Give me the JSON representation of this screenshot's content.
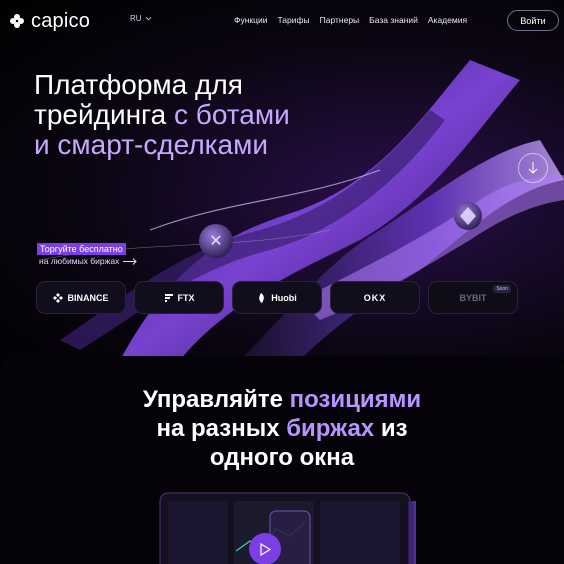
{
  "header": {
    "logo_text": "capico",
    "lang": "RU",
    "nav": [
      "Функции",
      "Тарифы",
      "Партнеры",
      "База знаний",
      "Академия"
    ],
    "login_label": "Войти"
  },
  "hero": {
    "headline_line1": "Платформа для",
    "headline_line2_white": "трейдинга",
    "headline_line2_purple": " с ботами",
    "headline_line3": "и смарт-сделками",
    "trade_badge": "Торгуйте бесплатно",
    "trade_sub": "на любимых биржах",
    "exchanges": [
      {
        "label": "BINANCE",
        "icon": "binance-icon"
      },
      {
        "label": "FTX",
        "icon": "ftx-icon"
      },
      {
        "label": "Huobi",
        "icon": "huobi-icon"
      },
      {
        "label": "OKX",
        "icon": "okx-icon"
      },
      {
        "label": "BYBIT",
        "icon": "bybit-icon",
        "tag": "Soon"
      }
    ]
  },
  "manage": {
    "line1_white": "Управляйте ",
    "line1_purple": "позициями",
    "line2_white": "на разных ",
    "line2_purple": "биржах",
    "line2_white2": " из",
    "line3": "одного окна"
  },
  "colors": {
    "accent": "#7b3fe4",
    "headline_purple": "#c7a8ff",
    "background": "#000000"
  }
}
